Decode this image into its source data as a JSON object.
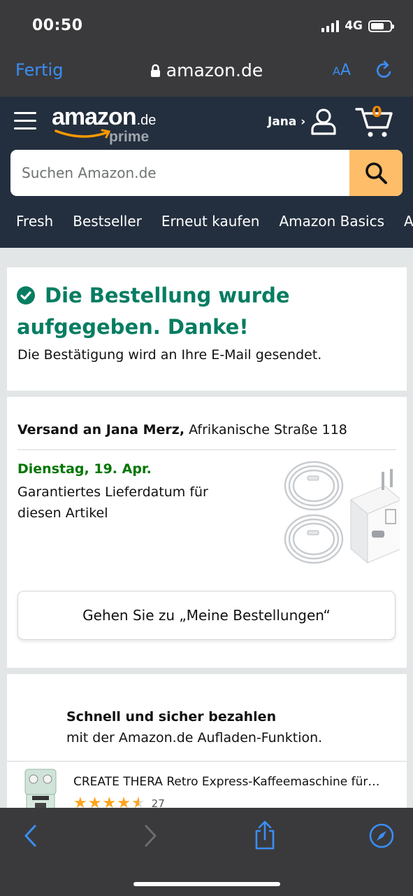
{
  "status_bar": {
    "time": "00:50",
    "network": "4G"
  },
  "browser": {
    "done_label": "Fertig",
    "url": "amazon.de",
    "text_size_label_small": "A",
    "text_size_label_large": "A",
    "icons": [
      "lock-icon",
      "reload-icon",
      "back-icon",
      "forward-icon",
      "share-icon",
      "compass-icon"
    ]
  },
  "header": {
    "logo_word": "amazon",
    "logo_tld": ".de",
    "logo_prime": "prime",
    "user_label": "Jana ›",
    "cart_count": "0",
    "search_placeholder": "Suchen Amazon.de",
    "nav_items": [
      "Fresh",
      "Bestseller",
      "Erneut kaufen",
      "Amazon Basics",
      "A"
    ]
  },
  "confirmation": {
    "title": "Die Bestellung wurde aufgegeben. Danke!",
    "subtitle": "Die Bestätigung wird an Ihre E-Mail gesendet."
  },
  "shipping": {
    "ship_to_label": "Versand an Jana Merz,",
    "address": "Afrikanische Straße 118",
    "delivery_date": "Dienstag, 19. Apr.",
    "delivery_note": "Garantiertes Lieferdatum für diesen Artikel",
    "orders_button": "Gehen Sie zu „Meine Bestellungen“"
  },
  "payment_promo": {
    "title": "Schnell und sicher bezahlen",
    "subtitle": "mit der Amazon.de Aufladen-Funktion."
  },
  "recommendation": {
    "title": "CREATE THERA Retro Express-Kaffeemaschine für…",
    "rating": 4.5,
    "review_count": "27"
  },
  "colors": {
    "amazon_dark": "#232f3e",
    "search_button": "#febd69",
    "success_green": "#067d62",
    "delivery_green": "#007600",
    "ios_blue": "#3a8ef6"
  }
}
